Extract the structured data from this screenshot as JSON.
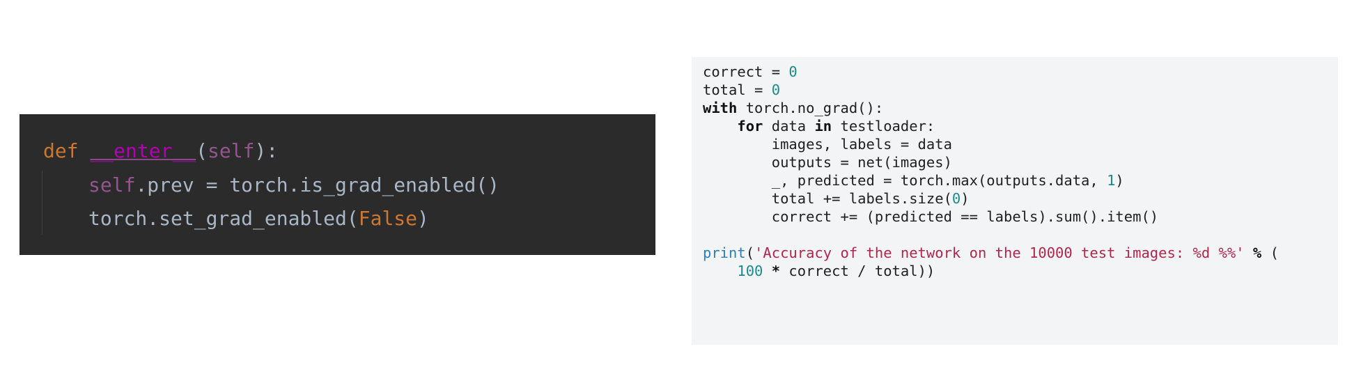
{
  "left_panel": {
    "language": "python",
    "theme": "dark",
    "line1": {
      "def": "def",
      "space1": " ",
      "fn": "__enter__",
      "open": "(",
      "self": "self",
      "close": "):"
    },
    "line2": {
      "self": "self",
      "rest": ".prev = torch.is_grad_enabled()"
    },
    "line3": {
      "pre": "torch.set_grad_enabled(",
      "false": "False",
      "post": ")"
    }
  },
  "right_panel": {
    "language": "python",
    "theme": "light",
    "lines": [
      {
        "a": "correct = ",
        "num": "0"
      },
      {
        "a": "total = ",
        "num": "0"
      },
      {
        "kw": "with",
        "a": " torch.no_grad():"
      },
      {
        "indent": "    ",
        "kw": "for",
        "a": " data ",
        "kw2": "in",
        "b": " testloader:"
      },
      {
        "text": "        images, labels = data"
      },
      {
        "text": "        outputs = net(images)"
      },
      {
        "pre": "        _, predicted = torch.max(outputs.data, ",
        "num": "1",
        "post": ")"
      },
      {
        "pre": "        total += labels.size(",
        "num": "0",
        "post": ")"
      },
      {
        "text": "        correct += (predicted == labels).sum().item()"
      },
      {
        "text": ""
      },
      {
        "builtin": "print",
        "open": "(",
        "str": "'Accuracy of the network on the 10000 test images: %d %%'",
        "mid": " ",
        "op": "%",
        "post": " ("
      },
      {
        "indent": "    ",
        "num": "100",
        "mid": " ",
        "op": "*",
        "post": " correct / total))"
      }
    ]
  },
  "colors": {
    "dark_bg": "#2b2b2b",
    "light_bg": "#f3f4f6",
    "keyword_orange": "#cc7832",
    "magic_method": "#b200b2",
    "self_purple": "#94558d",
    "number_teal": "#1b8a8a",
    "string_red": "#b0264b",
    "builtin_blue": "#2c7fb8"
  }
}
